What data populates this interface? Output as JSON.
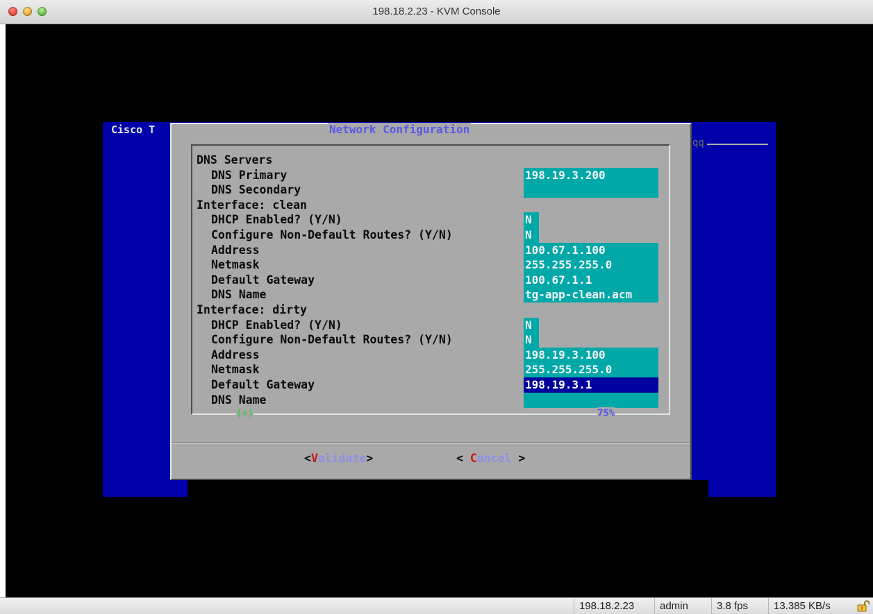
{
  "window": {
    "title": "198.18.2.23 - KVM Console"
  },
  "background": {
    "label": "Cisco T",
    "fragment": "qq"
  },
  "dialog": {
    "title": "Network Configuration",
    "rows": [
      {
        "label": "DNS Servers",
        "indent": 0
      },
      {
        "label": "DNS Primary",
        "indent": 1,
        "value": "198.19.3.200"
      },
      {
        "label": "DNS Secondary",
        "indent": 1,
        "value": ""
      },
      {
        "label": "Interface: clean",
        "indent": 0
      },
      {
        "label": "DHCP Enabled? (Y/N)",
        "indent": 1,
        "value": "N",
        "small": true
      },
      {
        "label": "Configure Non-Default Routes? (Y/N)",
        "indent": 1,
        "value": "N",
        "small": true
      },
      {
        "label": "Address",
        "indent": 1,
        "value": "100.67.1.100"
      },
      {
        "label": "Netmask",
        "indent": 1,
        "value": "255.255.255.0"
      },
      {
        "label": "Default Gateway",
        "indent": 1,
        "value": "100.67.1.1"
      },
      {
        "label": "DNS Name",
        "indent": 1,
        "value": "tg-app-clean.acm"
      },
      {
        "label": "Interface: dirty",
        "indent": 0
      },
      {
        "label": "DHCP Enabled? (Y/N)",
        "indent": 1,
        "value": "N",
        "small": true
      },
      {
        "label": "Configure Non-Default Routes? (Y/N)",
        "indent": 1,
        "value": "N",
        "small": true
      },
      {
        "label": "Address",
        "indent": 1,
        "value": "198.19.3.100"
      },
      {
        "label": "Netmask",
        "indent": 1,
        "value": "255.255.255.0"
      },
      {
        "label": "Default Gateway",
        "indent": 1,
        "value": "198.19.3.1",
        "focused": true
      },
      {
        "label": "DNS Name",
        "indent": 1,
        "value": ""
      }
    ],
    "scroll_indicator": "(+)",
    "scroll_percent": "75%",
    "buttons": {
      "validate": {
        "open": "<",
        "hotkey": "V",
        "rest": "alidate",
        "close": ">"
      },
      "cancel": {
        "open": "< ",
        "hotkey": "C",
        "rest": "ancel",
        "close": " >"
      }
    }
  },
  "statusbar": {
    "host": "198.18.2.23",
    "user": "admin",
    "fps": "3.8 fps",
    "rate": "13.385 KB/s",
    "lock_icon": "unlocked-padlock-icon"
  },
  "colors": {
    "field_bg": "#00a8a8",
    "field_focus_bg": "#00009c",
    "dialog_bg": "#a9a9a9",
    "screen_blue": "#0000aa",
    "hotkey": "#c41a1a"
  }
}
